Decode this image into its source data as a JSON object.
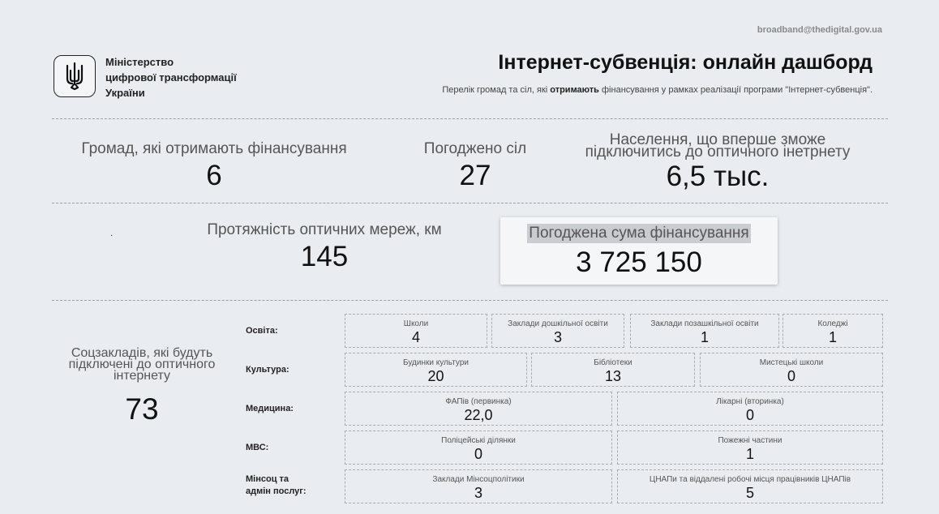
{
  "header": {
    "email": "broadband@thedigital.gov.ua",
    "ministry_line1": "Міністерство",
    "ministry_line2": "цифрової трансформації",
    "ministry_line3": "України",
    "logo_icon": "trident-icon",
    "title": "Інтернет-субвенція: онлайн дашборд",
    "subtitle_before": "Перелік громад та сіл, які ",
    "subtitle_bold": "отримають",
    "subtitle_after": " фінансування у рамках реалізації програми \"Інтернет-субвенція\"."
  },
  "kpis": {
    "communities": {
      "label": "Громад, які отримають фінансування",
      "value": "6"
    },
    "villages": {
      "label": "Погоджено сіл",
      "value": "27"
    },
    "population": {
      "label_line1": "Населення, що вперше зможе",
      "label_line2": "підключитись до оптичного інетрнету",
      "value": "6,5 тыс."
    },
    "network": {
      "label": "Протяжність оптичних мереж, км",
      "value": "145"
    },
    "funding": {
      "label": "Погоджена сума фінансування",
      "value": "3 725 150"
    },
    "dot": "."
  },
  "social": {
    "label_line1": "Соцзакладів, які будуть",
    "label_line2": "підключені до оптичного",
    "label_line3": "інтернету",
    "value": "73",
    "rows": [
      {
        "label": "Освіта:",
        "cells": [
          {
            "label": "Школи",
            "value": "4"
          },
          {
            "label": "Заклади дошкільної освіти",
            "value": "3"
          },
          {
            "label": "Заклади позашкільної освіти",
            "value": "1"
          },
          {
            "label": "Коледжі",
            "value": "1"
          }
        ]
      },
      {
        "label": "Культура:",
        "cells": [
          {
            "label": "Будинки культури",
            "value": "20"
          },
          {
            "label": "Бібліотеки",
            "value": "13"
          },
          {
            "label": "Мистецькі школи",
            "value": "0"
          }
        ]
      },
      {
        "label": "Медицина:",
        "cells": [
          {
            "label": "ФАПів (первинка)",
            "value": "22,0"
          },
          {
            "label": "Лікарні (вторинка)",
            "value": "0"
          }
        ]
      },
      {
        "label": "МВС:",
        "cells": [
          {
            "label": "Поліцейські ділянки",
            "value": "0"
          },
          {
            "label": "Пожежні частини",
            "value": "1"
          }
        ]
      },
      {
        "label_line1": "Мінсоц та",
        "label_line2": "адмін послуг:",
        "cells": [
          {
            "label": "Заклади Мінсоцполітики",
            "value": "3"
          },
          {
            "label": "ЦНАПи та віддалені робочі місця працівників ЦНАПів",
            "value": "5"
          }
        ]
      }
    ]
  }
}
